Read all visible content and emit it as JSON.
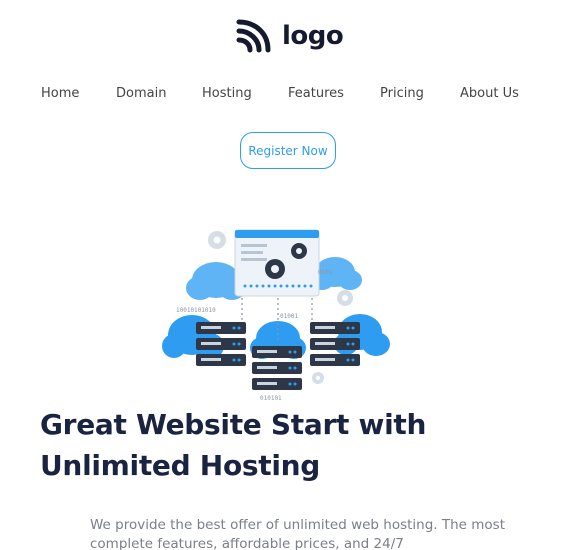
{
  "brand": {
    "logo_text": "logo",
    "accent_color": "#2e9cf1",
    "heading_color": "#1a2340"
  },
  "nav": {
    "items": [
      {
        "label": "Home"
      },
      {
        "label": "Domain"
      },
      {
        "label": "Hosting"
      },
      {
        "label": "Features"
      },
      {
        "label": "Pricing"
      },
      {
        "label": "About Us"
      }
    ]
  },
  "cta": {
    "register_label": "Register Now"
  },
  "hero": {
    "illustration_labels": [
      "0101",
      "10010101010",
      "01001",
      "010101"
    ],
    "title": "Great Website Start with Unlimited Hosting",
    "description": "We provide the best offer of unlimited web hosting. The most complete features, affordable prices, and 24/7"
  }
}
